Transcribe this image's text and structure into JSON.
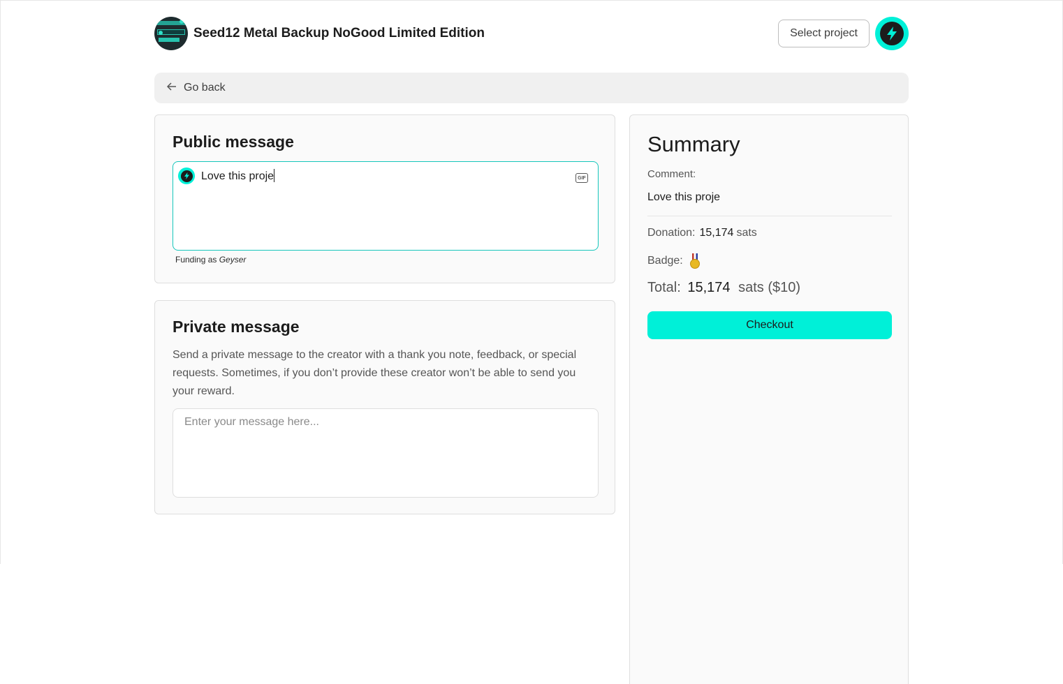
{
  "header": {
    "project_title": "Seed12 Metal Backup NoGood Limited Edition",
    "select_project_label": "Select project"
  },
  "nav": {
    "go_back_label": "Go back"
  },
  "public_message": {
    "title": "Public message",
    "value": "Love this proje",
    "funding_as_prefix": "Funding as",
    "funding_as_name": "Geyser",
    "gif_label": "GIF"
  },
  "private_message": {
    "title": "Private message",
    "description": "Send a private message to the creator with a thank you note, feedback, or special requests. Sometimes, if you don’t provide these creator won’t be able to send you your reward.",
    "placeholder": "Enter your message here..."
  },
  "summary": {
    "title": "Summary",
    "comment_label": "Comment:",
    "comment_value": "Love this proje",
    "donation_label": "Donation:",
    "donation_amount": "15,174",
    "donation_unit": "sats",
    "badge_label": "Badge:",
    "total_label": "Total:",
    "total_amount": "15,174",
    "total_unit": "sats",
    "total_usd": "($10)",
    "checkout_label": "Checkout"
  },
  "colors": {
    "accent": "#00f0d8",
    "focus_border": "#15c6bb"
  }
}
